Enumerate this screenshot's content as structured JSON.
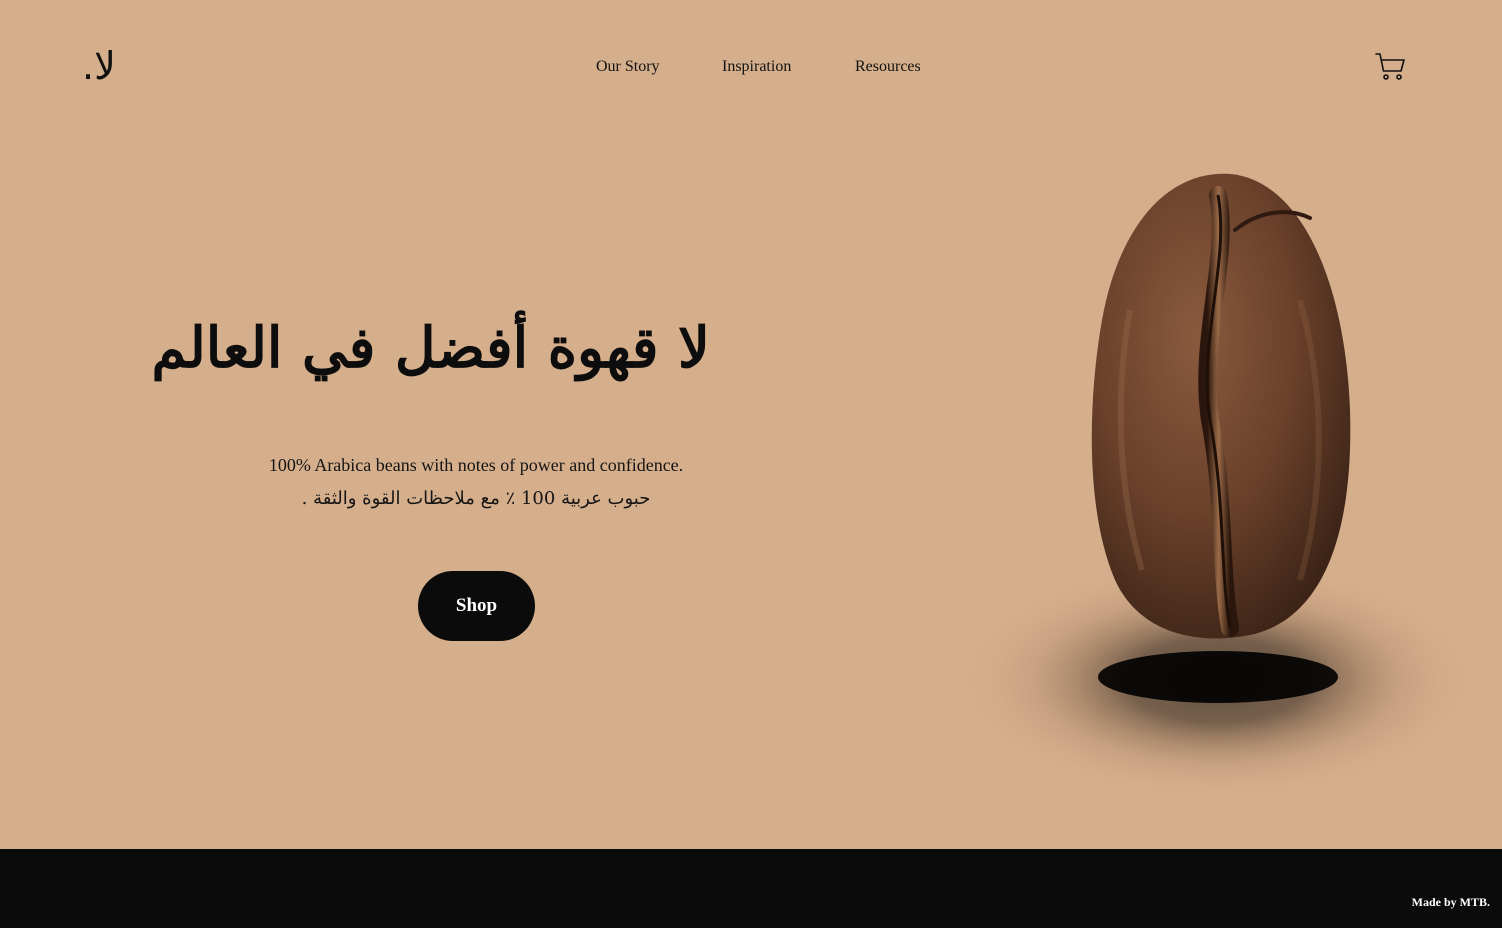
{
  "brand": {
    "logo_text": "لا."
  },
  "nav": {
    "items": [
      {
        "label": "Our Story"
      },
      {
        "label": "Inspiration"
      },
      {
        "label": "Resources"
      }
    ]
  },
  "header": {
    "cart_icon": "cart-icon"
  },
  "hero": {
    "headline": "لا قهوة أفضل في العالم",
    "subtitle_en": "100% Arabica beans with notes of power and confidence.",
    "subtitle_ar": "حبوب عربية 100 ٪ مع ملاحظات القوة والثقة .",
    "cta_label": "Shop",
    "image_icon": "coffee-bean-image"
  },
  "footer": {
    "credit": "Made by MTB."
  },
  "colors": {
    "background": "#d5ae8b",
    "footer": "#0b0b0c",
    "button": "#0b0b0b",
    "text": "#111111"
  }
}
